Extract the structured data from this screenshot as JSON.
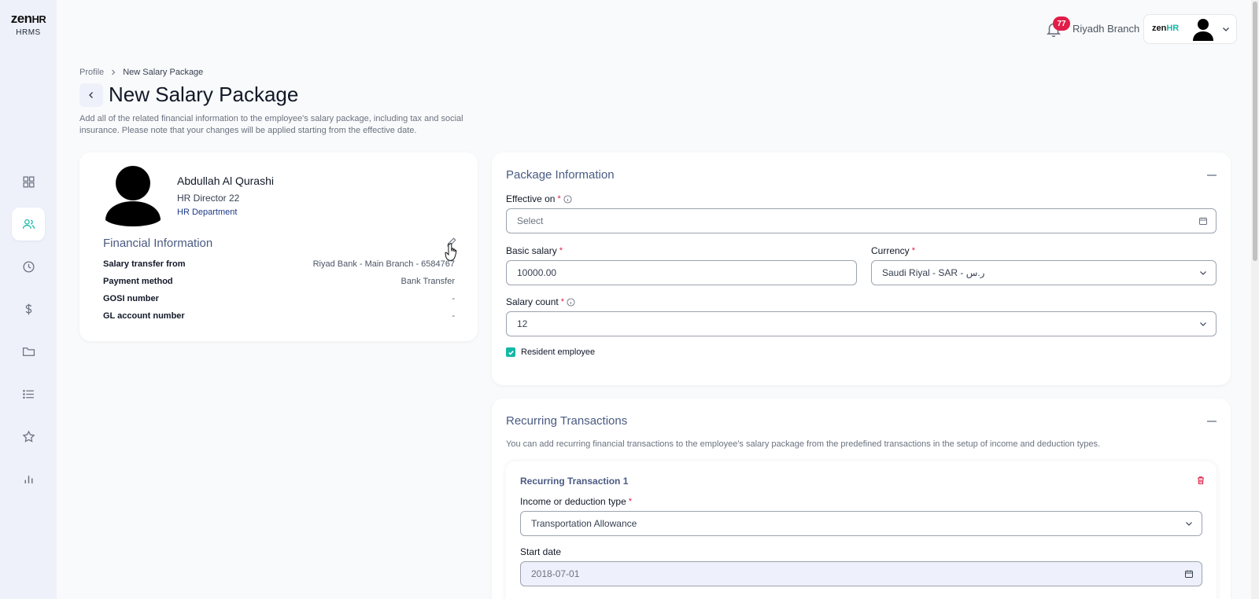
{
  "brand": {
    "name": "zen",
    "name_suffix": "HR",
    "sub": "HRMS"
  },
  "sidebar": {
    "items": [
      {
        "icon": "grid-icon",
        "active": false
      },
      {
        "icon": "users-icon",
        "active": true
      },
      {
        "icon": "clock-icon",
        "active": false
      },
      {
        "icon": "dollar-icon",
        "active": false
      },
      {
        "icon": "folder-icon",
        "active": false
      },
      {
        "icon": "list-icon",
        "active": false
      },
      {
        "icon": "star-icon",
        "active": false
      },
      {
        "icon": "bar-chart-icon",
        "active": false
      }
    ]
  },
  "topbar": {
    "notification_count": "77",
    "branch": "Riyadh Branch",
    "account_logo": "zen",
    "account_logo_suffix": "HR"
  },
  "breadcrumb": {
    "parent": "Profile",
    "current": "New Salary Package"
  },
  "page": {
    "title": "New Salary Package",
    "description": "Add all of the related financial information to the employee's salary package, including tax and social insurance. Please note that your changes will be applied starting from the effective date."
  },
  "employee": {
    "name": "Abdullah Al Qurashi",
    "title": "HR Director 22",
    "department": "HR Department"
  },
  "financial": {
    "title": "Financial Information",
    "rows": [
      {
        "label": "Salary transfer from",
        "value": "Riyad Bank - Main Branch - 6584767"
      },
      {
        "label": "Payment method",
        "value": "Bank Transfer"
      },
      {
        "label": "GOSI number",
        "value": "-"
      },
      {
        "label": "GL account number",
        "value": "-"
      }
    ]
  },
  "package": {
    "title": "Package Information",
    "effective_on_label": "Effective on",
    "effective_on_placeholder": "Select",
    "basic_salary_label": "Basic salary",
    "basic_salary_value": "10000.00",
    "currency_label": "Currency",
    "currency_value": "Saudi Riyal - SAR - ر.س",
    "salary_count_label": "Salary count",
    "salary_count_value": "12",
    "resident_label": "Resident employee",
    "resident_checked": true,
    "required_mark": "*"
  },
  "recurring": {
    "title": "Recurring Transactions",
    "description": "You can add recurring financial transactions to the employee's salary package from the predefined transactions in the setup of income and deduction types.",
    "item_title": "Recurring Transaction 1",
    "type_label": "Income or deduction type",
    "type_value": "Transportation Allowance",
    "start_label": "Start date",
    "start_value": "2018-07-01"
  },
  "colors": {
    "accent": "#14b8a6",
    "badge": "#e11d48",
    "section_title": "#4a5a82",
    "sidebar_bg": "#eef1fa"
  }
}
